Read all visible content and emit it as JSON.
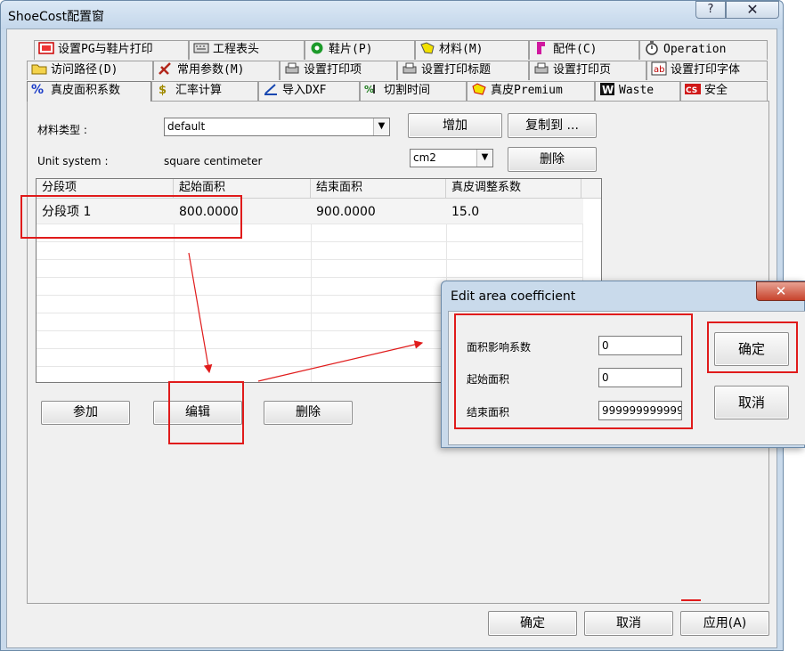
{
  "window": {
    "title": "ShoeCost配置窗",
    "help": "?",
    "close": "✕"
  },
  "tabs_row1": [
    {
      "label": "设置PG与鞋片打印",
      "icon": "print-setup-icon"
    },
    {
      "label": "工程表头",
      "icon": "keyboard-icon"
    },
    {
      "label": "鞋片(P)",
      "icon": "shoe-piece-icon"
    },
    {
      "label": "材料(M)",
      "icon": "material-icon"
    },
    {
      "label": "配件(C)",
      "icon": "accessory-icon"
    },
    {
      "label": "Operation",
      "icon": "stopwatch-icon"
    }
  ],
  "tabs_row2": [
    {
      "label": "访问路径(D)",
      "icon": "folder-icon"
    },
    {
      "label": "常用参数(M)",
      "icon": "tools-icon"
    },
    {
      "label": "设置打印项",
      "icon": "printer-icon"
    },
    {
      "label": "设置打印标题",
      "icon": "printer-icon"
    },
    {
      "label": "设置打印页",
      "icon": "printer-icon"
    },
    {
      "label": "设置打印字体",
      "icon": "font-icon"
    }
  ],
  "tabs_row3": [
    {
      "label": "真皮面积系数",
      "icon": "percent-icon"
    },
    {
      "label": "汇率计算",
      "icon": "currency-icon"
    },
    {
      "label": "导入DXF",
      "icon": "import-icon"
    },
    {
      "label": "切割时间",
      "icon": "cut-icon"
    },
    {
      "label": "真皮Premium",
      "icon": "premium-icon"
    },
    {
      "label": "Waste",
      "icon": "waste-icon"
    },
    {
      "label": "安全",
      "icon": "security-icon"
    }
  ],
  "panel": {
    "material_type_label": "材料类型 :",
    "material_type_value": "default",
    "unit_system_label": "Unit system :",
    "unit_system_value": "square centimeter",
    "unit_select": "cm2",
    "add_button": "增加",
    "copy_to_button": "复制到 ...",
    "delete_top_button": "删除"
  },
  "table": {
    "headers": [
      "分段项",
      "起始面积",
      "结束面积",
      "真皮调整系数"
    ],
    "rows": [
      [
        "分段项 1",
        "800.0000",
        "900.0000",
        "15.0"
      ]
    ]
  },
  "panel_buttons": {
    "add": "参加",
    "edit": "编辑",
    "delete": "删除"
  },
  "footer": {
    "ok": "确定",
    "cancel": "取消",
    "apply": "应用(A)"
  },
  "dialog": {
    "title": "Edit area coefficient",
    "close": "✕",
    "fields": [
      {
        "label": "面积影响系数",
        "value": "0"
      },
      {
        "label": "起始面积",
        "value": "0"
      },
      {
        "label": "结束面积",
        "value": "999999999999"
      }
    ],
    "ok": "确定",
    "cancel": "取消"
  },
  "colors": {
    "annotation_red": "#e01b1b",
    "window_frame": "#c9daeb",
    "face": "#f0f0f0"
  }
}
